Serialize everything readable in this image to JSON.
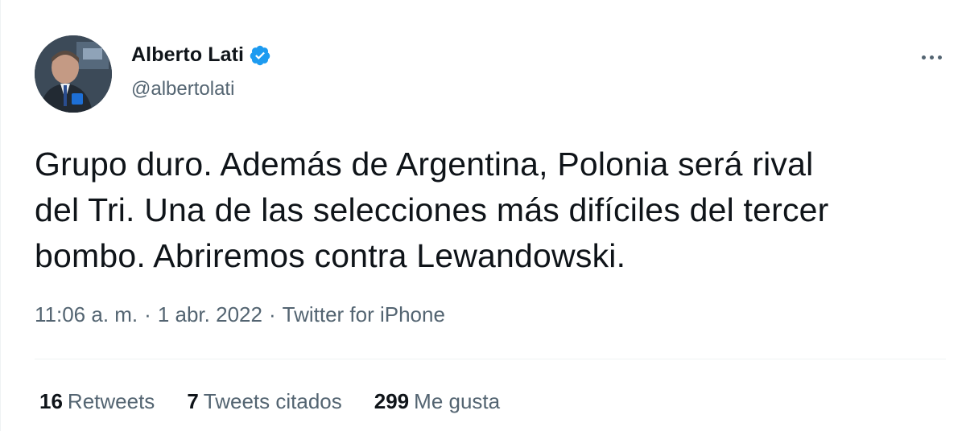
{
  "author": {
    "name": "Alberto Lati",
    "handle": "@albertolati",
    "verified": true,
    "avatar_icon": "avatar-photo"
  },
  "tweet": {
    "line1": "Grupo duro. Además de Argentina, Polonia será rival",
    "line2": "del Tri. Una de las selecciones más difíciles del tercer",
    "line3": "bombo. Abriremos contra Lewandowski.",
    "time": "11:06 a. m.",
    "separator": "·",
    "date": "1 abr. 2022",
    "source": "Twitter for iPhone"
  },
  "stats": {
    "retweets_count": "16",
    "retweets_label": "Retweets",
    "quotes_count": "7",
    "quotes_label": "Tweets citados",
    "likes_count": "299",
    "likes_label": "Me gusta"
  },
  "colors": {
    "text": "#0f1419",
    "secondary": "#536471",
    "verified": "#1d9bf0",
    "divider": "#eff3f4"
  }
}
